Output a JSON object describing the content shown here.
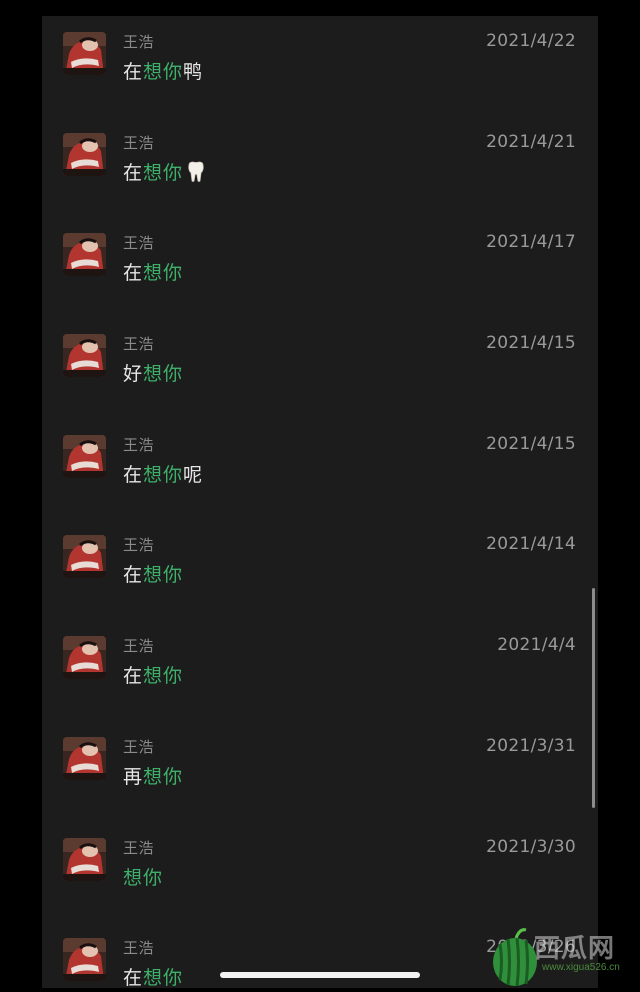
{
  "conversations": [
    {
      "name": "王浩",
      "date": "2021/4/22",
      "prefix": "在",
      "highlight": "想你",
      "suffix": "鸭",
      "emoji": ""
    },
    {
      "name": "王浩",
      "date": "2021/4/21",
      "prefix": "在",
      "highlight": "想你",
      "suffix": "",
      "emoji": "tooth-icon"
    },
    {
      "name": "王浩",
      "date": "2021/4/17",
      "prefix": "在",
      "highlight": "想你",
      "suffix": "",
      "emoji": ""
    },
    {
      "name": "王浩",
      "date": "2021/4/15",
      "prefix": "好",
      "highlight": "想你",
      "suffix": "",
      "emoji": ""
    },
    {
      "name": "王浩",
      "date": "2021/4/15",
      "prefix": "在",
      "highlight": "想你",
      "suffix": "呢",
      "emoji": ""
    },
    {
      "name": "王浩",
      "date": "2021/4/14",
      "prefix": "在",
      "highlight": "想你",
      "suffix": "",
      "emoji": ""
    },
    {
      "name": "王浩",
      "date": "2021/4/4",
      "prefix": "在",
      "highlight": "想你",
      "suffix": "",
      "emoji": ""
    },
    {
      "name": "王浩",
      "date": "2021/3/31",
      "prefix": "再",
      "highlight": "想你",
      "suffix": "",
      "emoji": ""
    },
    {
      "name": "王浩",
      "date": "2021/3/30",
      "prefix": "",
      "highlight": "想你",
      "suffix": "",
      "emoji": ""
    },
    {
      "name": "王浩",
      "date": "2021/3/26",
      "prefix": "在",
      "highlight": "想你",
      "suffix": "",
      "emoji": ""
    }
  ],
  "watermark": {
    "text": "西瓜网",
    "url": "www.xigua526.cn"
  },
  "colors": {
    "background": "#1c1c1c",
    "highlight": "#3fb06a",
    "message_text": "#e6e6e6",
    "meta_text": "#8a8a8a"
  }
}
